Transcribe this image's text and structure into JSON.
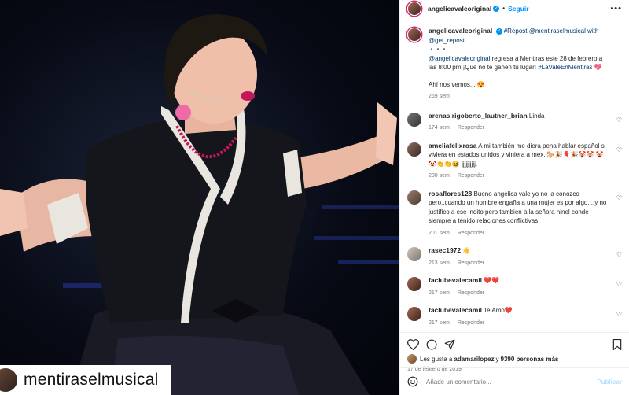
{
  "post": {
    "author": "angelicavaleoriginal",
    "follow_label": "Seguir",
    "more_icon": "more-horizontal-icon",
    "repost_overlay_name": "mentiraselmusical"
  },
  "caption": {
    "author": "angelicavaleoriginal",
    "line1": "#Repost @mentiraselmusical with @get_repost",
    "dots": "・・・",
    "text_mention": "@angelicavaleoriginal",
    "text_body": " regresa a Mentiras este 28 de febrero a las 8:00 pm ¡Que no te ganen tu lugar! ",
    "hashtag": "#LaValeEnMentiras",
    "hashtag_emoji": " 💖",
    "line3": "Ahí nos vemos... 😍",
    "time": "269 sem"
  },
  "comments": [
    {
      "user": "arenas.rigoberto_lautner_brian",
      "text": "Linda",
      "time": "174 sem",
      "reply": "Responder"
    },
    {
      "user": "ameliafelixrosa",
      "text": "A mi también me diera pena hablar español si viviera en estados unidos y viniera a mex. 🐎🎉🎈🎉🤡🤡 🤡🤡👏👏😆 jjjjjjjjjj.",
      "time": "200 sem",
      "reply": "Responder"
    },
    {
      "user": "rosaflores128",
      "text": "Bueno angelica vale yo no la conozco pero..cuando un hombre engaña a una mujer es por algo....y no justifico a ese indito pero tambien a la señora ninel conde siempre a tenido relaciones conflictivas",
      "time": "201 sem",
      "reply": "Responder"
    },
    {
      "user": "rasec1972",
      "text": "👋",
      "time": "213 sem",
      "reply": "Responder"
    },
    {
      "user": "faclubevalecamil",
      "text": "❤️❤️",
      "time": "217 sem",
      "reply": "Responder"
    },
    {
      "user": "faclubevalecamil",
      "text": "Te Amo❤️",
      "time": "217 sem",
      "reply": "Responder"
    }
  ],
  "likes": {
    "prefix": "Les gusta a ",
    "user": "adamarilopez",
    "mid": " y ",
    "count": "9390 personas más"
  },
  "date": "17 de febrero de 2019",
  "comment_input": {
    "placeholder": "Añade un comentario...",
    "publish_label": "Publicar"
  },
  "colors": {
    "accent": "#0095f6",
    "link": "#00376b",
    "muted": "#737373",
    "ring": "#d62976"
  }
}
